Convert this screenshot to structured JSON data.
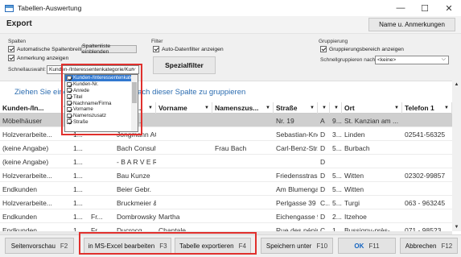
{
  "window": {
    "title": "Tabellen-Auswertung",
    "minimize": "—",
    "maximize": "☐",
    "close": "✕"
  },
  "header": {
    "title": "Export",
    "name_button": "Name u. Anmerkungen"
  },
  "options": {
    "spalten": {
      "title": "Spalten",
      "auto_width": "Automatische Spaltenbreite",
      "auto_width_checked": true,
      "list_button": "Spaltenliste einblenden",
      "show_notes": "Anmerkung anzeigen",
      "show_notes_checked": true,
      "quick_select_label": "Schnellauswahl:",
      "quick_select_value": "Kunden-/Interessentenkategorie/Kun"
    },
    "filter": {
      "title": "Filter",
      "auto_filter": "Auto-Datenfilter anzeigen",
      "auto_filter_checked": true,
      "special_button": "Spezialfilter"
    },
    "gruppierung": {
      "title": "Gruppierung",
      "show_area": "Gruppierungsbereich anzeigen",
      "show_area_checked": true,
      "quick_label": "Schnellgruppieren nach:",
      "quick_value": "<keine>"
    }
  },
  "dropdown": {
    "items": [
      {
        "label": "Kunden-/Interessentenkategorie",
        "checked": true,
        "highlighted": true
      },
      {
        "label": "Kunden-Nr.",
        "checked": true
      },
      {
        "label": "Anrede",
        "checked": true
      },
      {
        "label": "Titel",
        "checked": true
      },
      {
        "label": "Nachname/Firma",
        "checked": true
      },
      {
        "label": "Vorname",
        "checked": true
      },
      {
        "label": "Namenszusatz",
        "checked": true
      },
      {
        "label": "Straße",
        "checked": true
      }
    ]
  },
  "grouping_hint": "Ziehen Sie eine Spalte hierhin, um nach dieser Spalte zu gruppieren",
  "table": {
    "columns": [
      "Kunden-/In...",
      "K...",
      "A...",
      "Name/...",
      "Vorname",
      "Namenszus...",
      "Straße",
      "",
      "",
      "Ort",
      "Telefon 1"
    ],
    "rows": [
      [
        "Möbelhäuser",
        "1...",
        "",
        "Möbel...",
        "",
        "",
        "Nr. 19",
        "A",
        "9...",
        "St. Kanzian am ...",
        ""
      ],
      [
        "Holzverarbeite...",
        "1...",
        "",
        "Jongmann AG",
        "",
        "",
        "Sebastian-Knei...",
        "D",
        "3...",
        "Linden",
        "02541-56325"
      ],
      [
        "(keine Angabe)",
        "1...",
        "",
        "Bach Consulting",
        "",
        "Frau Bach",
        "Carl-Benz-Str. 2",
        "D",
        "5...",
        "Burbach",
        ""
      ],
      [
        "(keine Angabe)",
        "1...",
        "",
        "- B A R V E R K ...",
        "",
        "",
        "",
        "D",
        "",
        "",
        ""
      ],
      [
        "Holzverarbeite...",
        "1...",
        "",
        "Bau Kunze",
        "",
        "",
        "Friedensstrasse 7",
        "D",
        "5...",
        "Witten",
        "02302-99857"
      ],
      [
        "Endkunden",
        "1...",
        "",
        "Beier Gebr.",
        "",
        "",
        "Am Blumengar...",
        "D",
        "5...",
        "Witten",
        ""
      ],
      [
        "Holzverarbeite...",
        "1...",
        "",
        "Bruckmeier & P...",
        "",
        "",
        "Perlgasse 39 a",
        "C...",
        "5...",
        "Turgi",
        "063 - 963245"
      ],
      [
        "Endkunden",
        "1...",
        "Fr...",
        "Dombrowsky",
        "Martha",
        "",
        "Eichengasse 97",
        "D",
        "2...",
        "Itzehoe",
        ""
      ],
      [
        "Endkunden",
        "1...",
        "Fr...",
        "Ducrocq",
        "Chantale",
        "",
        "Rue des pépine...",
        "C...",
        "1...",
        "Bussigny-près-...",
        "071 - 98523"
      ]
    ]
  },
  "footer": {
    "preview": {
      "label": "Seitenvorschau",
      "key": "F2"
    },
    "excel": {
      "label": "in MS-Excel bearbeiten",
      "key": "F3"
    },
    "export": {
      "label": "Tabelle exportieren",
      "key": "F4"
    },
    "save": {
      "label": "Speichern unter",
      "key": "F10"
    },
    "ok": {
      "label": "OK",
      "key": "F11"
    },
    "cancel": {
      "label": "Abbrechen",
      "key": "F12"
    }
  },
  "colors": {
    "highlight": "#3178d0",
    "annotation_red": "#e0302d",
    "link_blue": "#2b6cb0"
  }
}
